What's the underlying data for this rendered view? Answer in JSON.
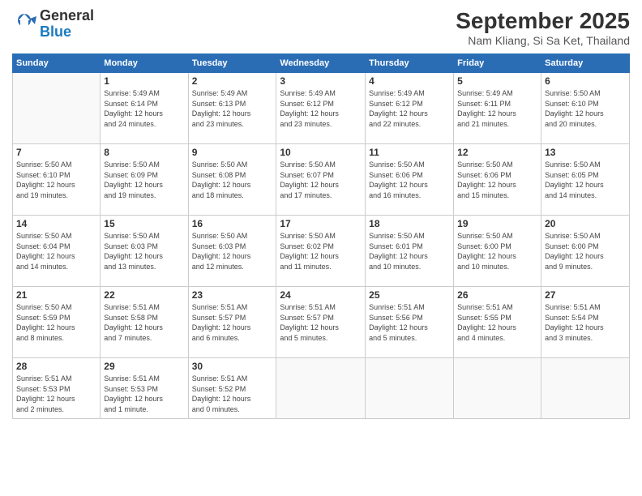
{
  "logo": {
    "general": "General",
    "blue": "Blue"
  },
  "title": "September 2025",
  "subtitle": "Nam Kliang, Si Sa Ket, Thailand",
  "headers": [
    "Sunday",
    "Monday",
    "Tuesday",
    "Wednesday",
    "Thursday",
    "Friday",
    "Saturday"
  ],
  "weeks": [
    [
      {
        "day": "",
        "info": ""
      },
      {
        "day": "1",
        "info": "Sunrise: 5:49 AM\nSunset: 6:14 PM\nDaylight: 12 hours\nand 24 minutes."
      },
      {
        "day": "2",
        "info": "Sunrise: 5:49 AM\nSunset: 6:13 PM\nDaylight: 12 hours\nand 23 minutes."
      },
      {
        "day": "3",
        "info": "Sunrise: 5:49 AM\nSunset: 6:12 PM\nDaylight: 12 hours\nand 23 minutes."
      },
      {
        "day": "4",
        "info": "Sunrise: 5:49 AM\nSunset: 6:12 PM\nDaylight: 12 hours\nand 22 minutes."
      },
      {
        "day": "5",
        "info": "Sunrise: 5:49 AM\nSunset: 6:11 PM\nDaylight: 12 hours\nand 21 minutes."
      },
      {
        "day": "6",
        "info": "Sunrise: 5:50 AM\nSunset: 6:10 PM\nDaylight: 12 hours\nand 20 minutes."
      }
    ],
    [
      {
        "day": "7",
        "info": "Sunrise: 5:50 AM\nSunset: 6:10 PM\nDaylight: 12 hours\nand 19 minutes."
      },
      {
        "day": "8",
        "info": "Sunrise: 5:50 AM\nSunset: 6:09 PM\nDaylight: 12 hours\nand 19 minutes."
      },
      {
        "day": "9",
        "info": "Sunrise: 5:50 AM\nSunset: 6:08 PM\nDaylight: 12 hours\nand 18 minutes."
      },
      {
        "day": "10",
        "info": "Sunrise: 5:50 AM\nSunset: 6:07 PM\nDaylight: 12 hours\nand 17 minutes."
      },
      {
        "day": "11",
        "info": "Sunrise: 5:50 AM\nSunset: 6:06 PM\nDaylight: 12 hours\nand 16 minutes."
      },
      {
        "day": "12",
        "info": "Sunrise: 5:50 AM\nSunset: 6:06 PM\nDaylight: 12 hours\nand 15 minutes."
      },
      {
        "day": "13",
        "info": "Sunrise: 5:50 AM\nSunset: 6:05 PM\nDaylight: 12 hours\nand 14 minutes."
      }
    ],
    [
      {
        "day": "14",
        "info": "Sunrise: 5:50 AM\nSunset: 6:04 PM\nDaylight: 12 hours\nand 14 minutes."
      },
      {
        "day": "15",
        "info": "Sunrise: 5:50 AM\nSunset: 6:03 PM\nDaylight: 12 hours\nand 13 minutes."
      },
      {
        "day": "16",
        "info": "Sunrise: 5:50 AM\nSunset: 6:03 PM\nDaylight: 12 hours\nand 12 minutes."
      },
      {
        "day": "17",
        "info": "Sunrise: 5:50 AM\nSunset: 6:02 PM\nDaylight: 12 hours\nand 11 minutes."
      },
      {
        "day": "18",
        "info": "Sunrise: 5:50 AM\nSunset: 6:01 PM\nDaylight: 12 hours\nand 10 minutes."
      },
      {
        "day": "19",
        "info": "Sunrise: 5:50 AM\nSunset: 6:00 PM\nDaylight: 12 hours\nand 10 minutes."
      },
      {
        "day": "20",
        "info": "Sunrise: 5:50 AM\nSunset: 6:00 PM\nDaylight: 12 hours\nand 9 minutes."
      }
    ],
    [
      {
        "day": "21",
        "info": "Sunrise: 5:50 AM\nSunset: 5:59 PM\nDaylight: 12 hours\nand 8 minutes."
      },
      {
        "day": "22",
        "info": "Sunrise: 5:51 AM\nSunset: 5:58 PM\nDaylight: 12 hours\nand 7 minutes."
      },
      {
        "day": "23",
        "info": "Sunrise: 5:51 AM\nSunset: 5:57 PM\nDaylight: 12 hours\nand 6 minutes."
      },
      {
        "day": "24",
        "info": "Sunrise: 5:51 AM\nSunset: 5:57 PM\nDaylight: 12 hours\nand 5 minutes."
      },
      {
        "day": "25",
        "info": "Sunrise: 5:51 AM\nSunset: 5:56 PM\nDaylight: 12 hours\nand 5 minutes."
      },
      {
        "day": "26",
        "info": "Sunrise: 5:51 AM\nSunset: 5:55 PM\nDaylight: 12 hours\nand 4 minutes."
      },
      {
        "day": "27",
        "info": "Sunrise: 5:51 AM\nSunset: 5:54 PM\nDaylight: 12 hours\nand 3 minutes."
      }
    ],
    [
      {
        "day": "28",
        "info": "Sunrise: 5:51 AM\nSunset: 5:53 PM\nDaylight: 12 hours\nand 2 minutes."
      },
      {
        "day": "29",
        "info": "Sunrise: 5:51 AM\nSunset: 5:53 PM\nDaylight: 12 hours\nand 1 minute."
      },
      {
        "day": "30",
        "info": "Sunrise: 5:51 AM\nSunset: 5:52 PM\nDaylight: 12 hours\nand 0 minutes."
      },
      {
        "day": "",
        "info": ""
      },
      {
        "day": "",
        "info": ""
      },
      {
        "day": "",
        "info": ""
      },
      {
        "day": "",
        "info": ""
      }
    ]
  ]
}
